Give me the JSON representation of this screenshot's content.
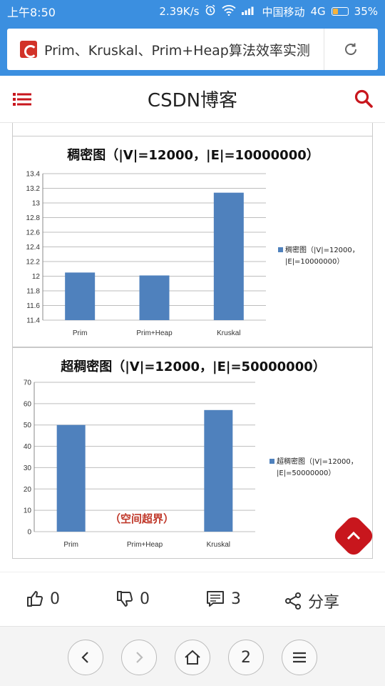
{
  "status": {
    "time": "上午8:50",
    "speed": "2.39K/s",
    "carrier": "中国移动",
    "network": "4G",
    "battery": "35%",
    "battery_level": 0.35
  },
  "browser": {
    "url_title": "Prim、Kruskal、Prim+Heap算法效率实测"
  },
  "header": {
    "title": "CSDN博客"
  },
  "colors": {
    "status_bar": "#3b8fe0",
    "bar": "#4f81bd",
    "accent_red": "#c8161d"
  },
  "chart_data": [
    {
      "type": "bar",
      "title": "稠密图（|V|=12000，|E|=10000000）",
      "categories": [
        "Prim",
        "Prim+Heap",
        "Kruskal"
      ],
      "values": [
        12.05,
        12.01,
        13.14
      ],
      "ylim": [
        11.4,
        13.4
      ],
      "yticks": [
        "13.4",
        "13.2",
        "13",
        "12.8",
        "12.6",
        "12.4",
        "12.2",
        "12",
        "11.8",
        "11.6",
        "11.4"
      ],
      "legend": [
        "稠密图（|V|=12000，",
        "|E|=10000000）"
      ],
      "grid": true,
      "legend_position": "right"
    },
    {
      "type": "bar",
      "title": "超稠密图（|V|=12000，|E|=50000000）",
      "categories": [
        "Prim",
        "Prim+Heap",
        "Kruskal"
      ],
      "values": [
        50,
        null,
        57
      ],
      "ylim": [
        0,
        70
      ],
      "yticks": [
        "70",
        "60",
        "50",
        "40",
        "30",
        "20",
        "10",
        "0"
      ],
      "legend": [
        "超稠密图（|V|=12000，",
        "|E|=50000000）"
      ],
      "annotation": "（空间超界）",
      "grid": true,
      "legend_position": "right"
    }
  ],
  "actions": {
    "like_count": "0",
    "dislike_count": "0",
    "comment_count": "3",
    "share_label": "分享"
  },
  "nav": {
    "tab_count": "2"
  }
}
